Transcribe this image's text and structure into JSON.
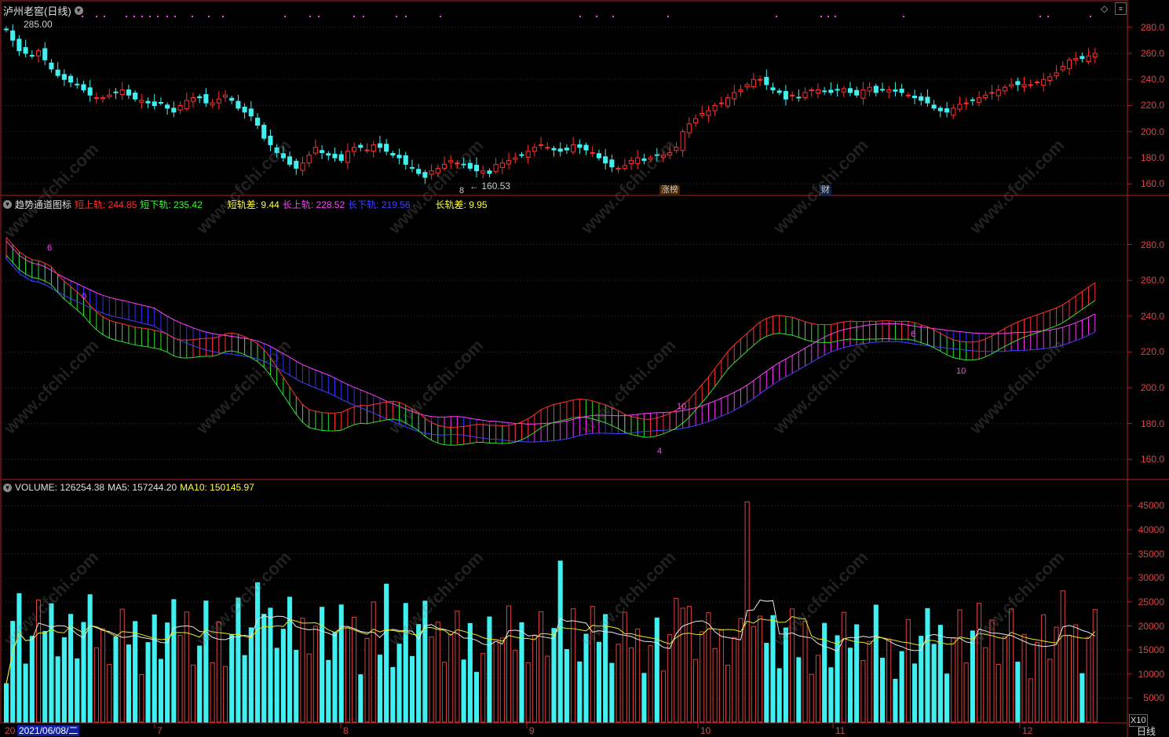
{
  "header": {
    "stock_title": "泸州老窖(日线)",
    "high_label": "285.00",
    "low_label": "160.53",
    "top_right_icons": [
      "diamond-icon",
      "up-arrow-icon",
      "down-arrow-icon"
    ]
  },
  "indicator": {
    "name": "趋势通道图标",
    "items": [
      {
        "label": "短上轨: 244.85",
        "color": "#ff3030"
      },
      {
        "label": "短下轨: 235.42",
        "color": "#30ff30"
      },
      {
        "label": "短轨差: 9.44",
        "color": "#ffff40"
      },
      {
        "label": "长上轨: 228.52",
        "color": "#ff40ff"
      },
      {
        "label": "长下轨: 219.56",
        "color": "#4040ff"
      },
      {
        "label": "长轨差: 9.95",
        "color": "#ffff40"
      }
    ],
    "markers": [
      "6",
      "0",
      "4",
      "10",
      "6",
      "10"
    ]
  },
  "volume": {
    "items": [
      {
        "label": "VOLUME: 126254.38",
        "color": "#e0e0e0"
      },
      {
        "label": "MA5: 157244.20",
        "color": "#e0e0e0"
      },
      {
        "label": "MA10: 150145.97",
        "color": "#ffff40"
      }
    ],
    "unit": "X10"
  },
  "badges": [
    {
      "text": "8",
      "color": "#ff4040"
    },
    {
      "text": "涨榜",
      "color": "#ffcc66"
    },
    {
      "text": "财",
      "color": "#66aaff"
    }
  ],
  "price_axis": [
    "280.0",
    "260.0",
    "240.0",
    "220.0",
    "200.0",
    "180.0",
    "160.0"
  ],
  "indicator_axis": [
    "280.0",
    "260.0",
    "240.0",
    "220.0",
    "200.0",
    "180.0",
    "160.0"
  ],
  "volume_axis": [
    "45000",
    "40000",
    "35000",
    "30000",
    "25000",
    "20000",
    "15000",
    "10000",
    "5000"
  ],
  "x_axis": {
    "date_label": "2021/06/08/二",
    "left_stub": "20",
    "months": [
      "7",
      "8",
      "9",
      "10",
      "11",
      "12"
    ],
    "period": "日线"
  },
  "watermark": "www.cfchi.com",
  "chart_data": {
    "type": "candlestick",
    "period": "daily",
    "n_bars": 118,
    "price_range": [
      153,
      290
    ],
    "key_points": [
      {
        "index": 2,
        "high": 285.0
      },
      {
        "index": 49,
        "low": 160.53
      }
    ],
    "close_approx": [
      278,
      270,
      262,
      260,
      258,
      262,
      255,
      248,
      243,
      240,
      238,
      236,
      232,
      228,
      226,
      226,
      228,
      230,
      232,
      228,
      225,
      224,
      222,
      220,
      222,
      218,
      215,
      220,
      224,
      226,
      226,
      222,
      222,
      225,
      228,
      224,
      218,
      215,
      212,
      205,
      195,
      190,
      184,
      180,
      175,
      172,
      176,
      182,
      188,
      184,
      182,
      180,
      178,
      185,
      188,
      188,
      186,
      190,
      188,
      185,
      182,
      180,
      175,
      172,
      168,
      165,
      170,
      172,
      175,
      178,
      176,
      175,
      172,
      170,
      170,
      168,
      175,
      176,
      178,
      180,
      182,
      185,
      188,
      190,
      188,
      186,
      185,
      186,
      190,
      188,
      186,
      184,
      180,
      176,
      173,
      172,
      174,
      178,
      180,
      178,
      180,
      182,
      182,
      184,
      188,
      200,
      206,
      210,
      214,
      216,
      220,
      222,
      226,
      230,
      232,
      236,
      240,
      240,
      236,
      232,
      230,
      225,
      228,
      226,
      230,
      232,
      232,
      231,
      230,
      232,
      233,
      230,
      228,
      232,
      234,
      230,
      232,
      232,
      231,
      230,
      228,
      226,
      224,
      222,
      218,
      216,
      215,
      218,
      221,
      222,
      224,
      226,
      228,
      230,
      232,
      234,
      236,
      236,
      236,
      236,
      238,
      240,
      242,
      245,
      250,
      255,
      256,
      256,
      258,
      260
    ],
    "short_channel": {
      "upper_last": 244.85,
      "lower_last": 235.42,
      "diff_last": 9.44
    },
    "long_channel": {
      "upper_last": 228.52,
      "lower_last": 219.56,
      "diff_last": 9.95
    },
    "volume_last": 126254.38,
    "volume_ma5": 157244.2,
    "volume_ma10": 150145.97
  }
}
